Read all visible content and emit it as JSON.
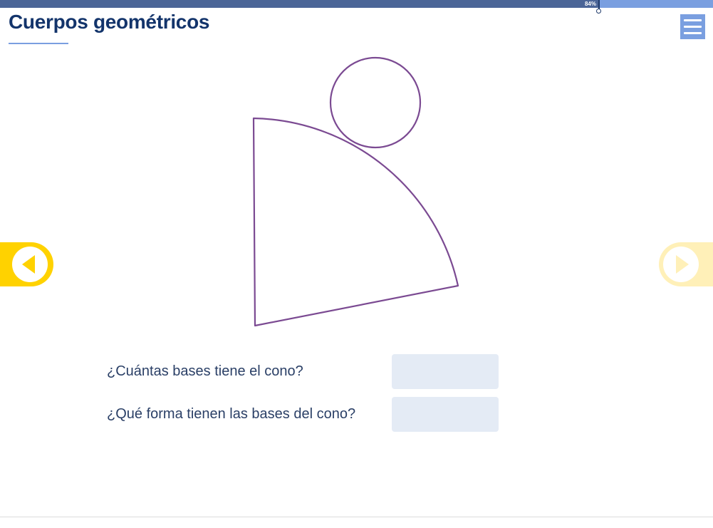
{
  "progress": {
    "percent": 84,
    "label": "84%",
    "fill_color": "#4b6597",
    "track_color": "#7a9fe0"
  },
  "header": {
    "title": "Cuerpos geométricos",
    "menu_icon": "hamburger-menu-icon"
  },
  "figure": {
    "description_shape": "cone-net",
    "stroke_color": "#7b4a92"
  },
  "navigation": {
    "prev_icon": "arrow-left-icon",
    "next_icon": "arrow-right-icon",
    "prev_color": "#ffd200",
    "next_color": "#fff0b8"
  },
  "questions": [
    {
      "text": "¿Cuántas bases tiene el cono?",
      "answer": ""
    },
    {
      "text": "¿Qué forma tienen las bases del cono?",
      "answer": ""
    }
  ]
}
